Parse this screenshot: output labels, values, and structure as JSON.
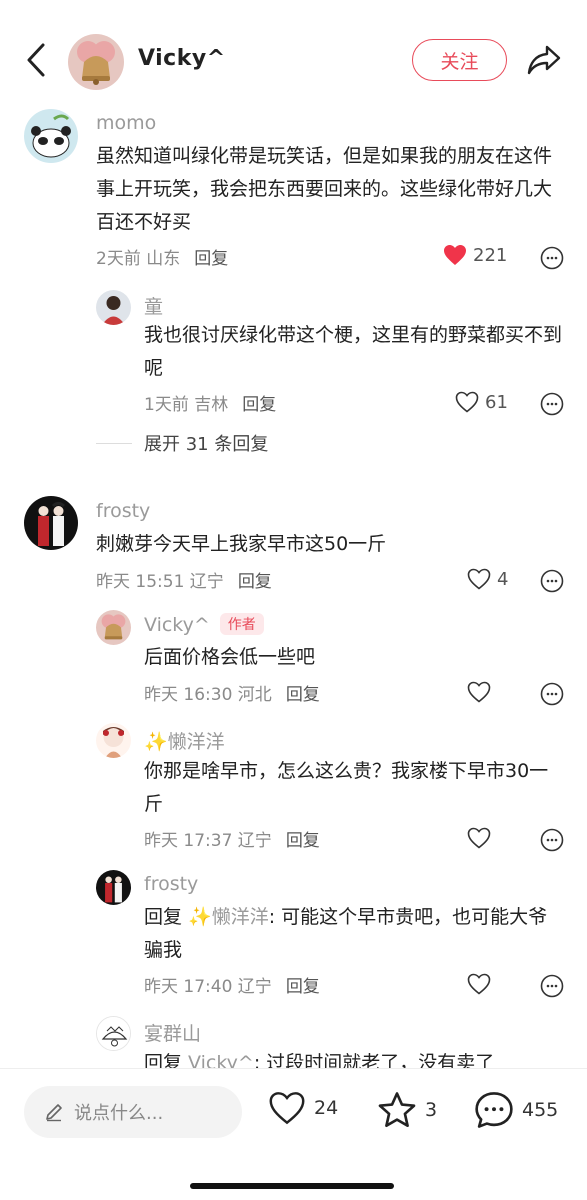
{
  "header": {
    "title": "Vicky^",
    "follow_label": "关注"
  },
  "comments": [
    {
      "user": "momo",
      "text": "虽然知道叫绿化带是玩笑话，但是如果我的朋友在这件事上开玩笑，我会把东西要回来的。这些绿化带好几大百还不好买",
      "time": "2天前 山东",
      "reply_label": "回复",
      "likes": "221"
    },
    {
      "user": "童",
      "text": "我也很讨厌绿化带这个梗，这里有的野菜都买不到呢",
      "time": "1天前 吉林",
      "reply_label": "回复",
      "likes": "61"
    },
    {
      "expand_label": "展开 31 条回复"
    },
    {
      "user": "frosty",
      "text": "刺嫩芽今天早上我家早市这50一斤",
      "time": "昨天 15:51 辽宁",
      "reply_label": "回复",
      "likes": "4"
    },
    {
      "user": "Vicky^",
      "author_tag": "作者",
      "text": "后面价格会低一些吧",
      "time": "昨天 16:30 河北",
      "reply_label": "回复"
    },
    {
      "user": "✨懒洋洋",
      "text": "你那是啥早市，怎么这么贵？我家楼下早市30一斤",
      "time": "昨天 17:37 辽宁",
      "reply_label": "回复"
    },
    {
      "user": "frosty",
      "text_prefix": "回复 ",
      "text_mention": "✨懒洋洋",
      "text_rest": ": 可能这个早市贵吧，也可能大爷骗我",
      "time": "昨天 17:40 辽宁",
      "reply_label": "回复"
    },
    {
      "user": "宴群山",
      "text_prefix": "回复 ",
      "text_mention": "Vicky^",
      "text_rest": ": 过段时间就老了，没有卖了"
    }
  ],
  "bottom_bar": {
    "input_placeholder": "说点什么...",
    "likes": "24",
    "stars": "3",
    "comments": "455"
  },
  "colors": {
    "accent": "#e84b5a",
    "liked_heart": "#f0344a",
    "muted_text": "#9a9a9a"
  },
  "icons": [
    "back-icon",
    "share-icon",
    "heart-icon",
    "more-icon",
    "pencil-icon",
    "star-icon",
    "comment-icon"
  ]
}
